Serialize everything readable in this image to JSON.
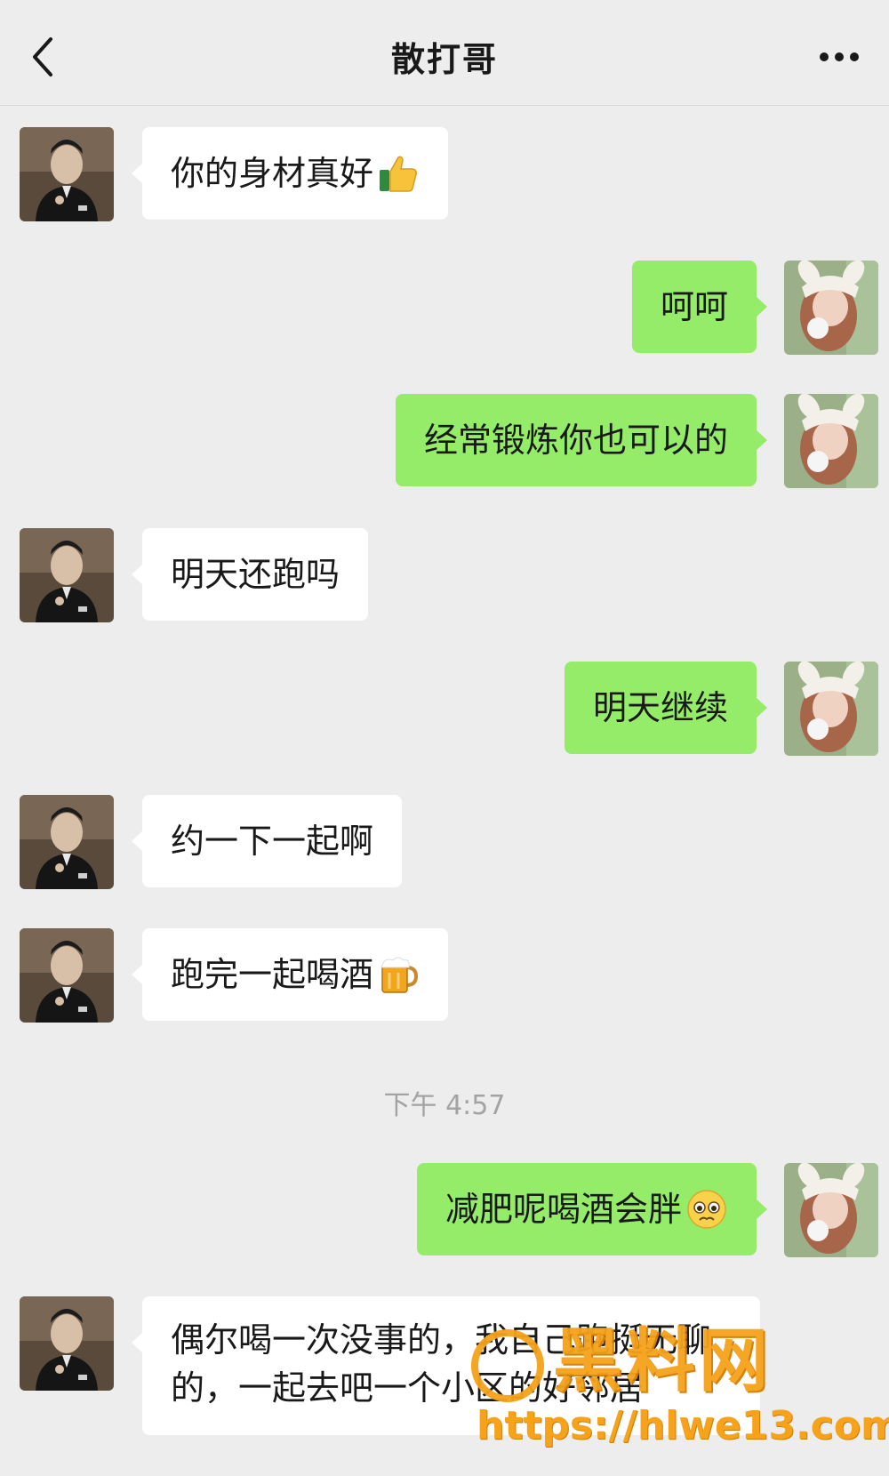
{
  "header": {
    "title": "散打哥",
    "back_icon": "chevron-left-icon",
    "more_icon": "more-horizontal-icon"
  },
  "messages": [
    {
      "side": "in",
      "text": "你的身材真好",
      "emoji": "thumbs-up"
    },
    {
      "side": "out",
      "text": "呵呵"
    },
    {
      "side": "out",
      "text": "经常锻炼你也可以的"
    },
    {
      "side": "in",
      "text": "明天还跑吗"
    },
    {
      "side": "out",
      "text": "明天继续"
    },
    {
      "side": "in",
      "text": "约一下一起啊"
    },
    {
      "side": "in",
      "text": "跑完一起喝酒",
      "emoji": "beer-mug"
    },
    {
      "side": "out",
      "text": "减肥呢喝酒会胖",
      "emoji": "pleading-face"
    },
    {
      "side": "in",
      "text": "偶尔喝一次没事的，我自己跑挺无聊的，一起去吧一个小区的好邻居"
    }
  ],
  "timestamp": "下午 4:57",
  "watermark": {
    "logo": "黑料网",
    "url": "https://hlwe13.com"
  },
  "colors": {
    "background": "#ededed",
    "incoming_bubble": "#ffffff",
    "outgoing_bubble": "#95ec69",
    "watermark": "#f6a21a"
  }
}
